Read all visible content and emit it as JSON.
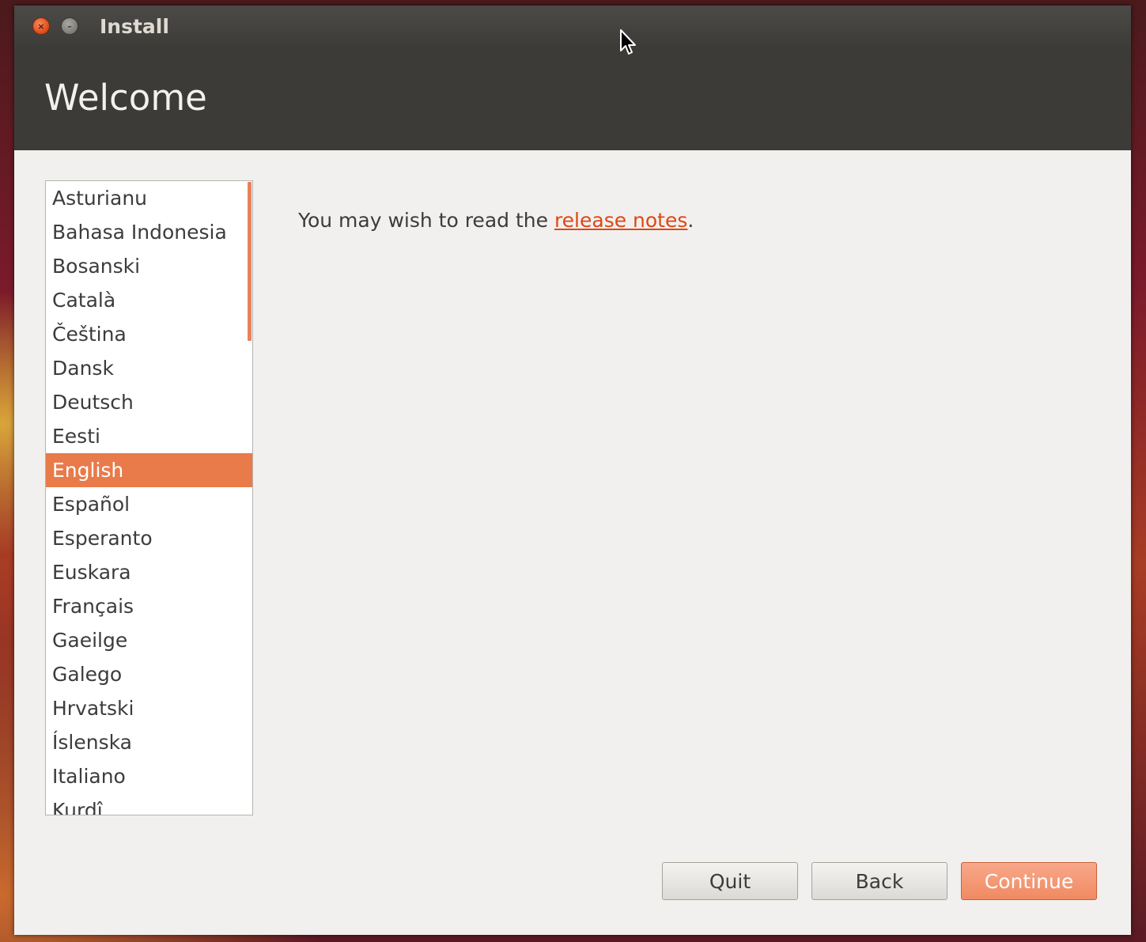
{
  "window": {
    "title": "Install",
    "close_glyph": "×",
    "minimize_glyph": "–"
  },
  "header": {
    "page_title": "Welcome"
  },
  "languages": {
    "items": [
      "Asturianu",
      "Bahasa Indonesia",
      "Bosanski",
      "Català",
      "Čeština",
      "Dansk",
      "Deutsch",
      "Eesti",
      "English",
      "Español",
      "Esperanto",
      "Euskara",
      "Français",
      "Gaeilge",
      "Galego",
      "Hrvatski",
      "Íslenska",
      "Italiano",
      "Kurdî"
    ],
    "selected": "English"
  },
  "release": {
    "prefix": "You may wish to read the ",
    "link_text": "release notes",
    "suffix": "."
  },
  "buttons": {
    "quit_label": "Quit",
    "back_label": "Back",
    "continue_label": "Continue"
  },
  "colors": {
    "accent": "#dd4814",
    "selection": "#e97a4a",
    "header_bg": "#3c3b37"
  }
}
